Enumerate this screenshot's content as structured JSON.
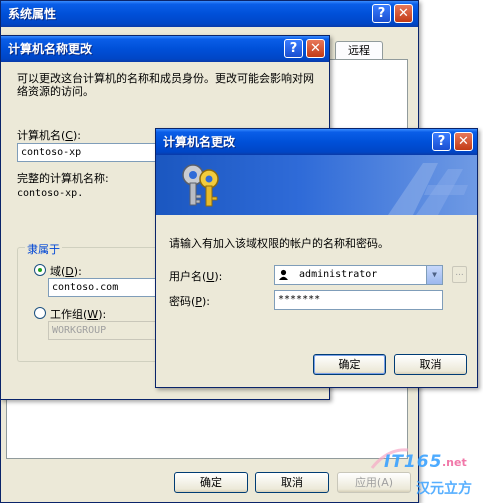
{
  "sysprops": {
    "title": "系统属性",
    "tab_remote": "远程",
    "ok": "确定",
    "cancel": "取消",
    "apply": "应用(A)"
  },
  "rename_dialog": {
    "title": "计算机名称更改",
    "description": "可以更改这台计算机的名称和成员身份。更改可能会影响对网络资源的访问。",
    "computer_name_label_pre": "计算机名(",
    "computer_name_key": "C",
    "computer_name_label_post": "):",
    "computer_name_value": "contoso-xp",
    "full_name_label": "完整的计算机名称:",
    "full_name_value": "contoso-xp.",
    "member_of_label": "隶属于",
    "domain_label_pre": "域(",
    "domain_key": "D",
    "domain_label_post": "):",
    "domain_value": "contoso.com",
    "workgroup_label_pre": "工作组(",
    "workgroup_key": "W",
    "workgroup_label_post": "):",
    "workgroup_value": "WORKGROUP"
  },
  "credentials_dialog": {
    "title": "计算机名更改",
    "prompt": "请输入有加入该域权限的帐户的名称和密码。",
    "username_label_pre": "用户名(",
    "username_key": "U",
    "username_label_post": "):",
    "username_value": "administrator",
    "password_label_pre": "密码(",
    "password_key": "P",
    "password_label_post": "):",
    "password_value": "*******",
    "browse_label": "...",
    "ok": "确定",
    "cancel": "取消"
  },
  "watermark": {
    "brand": "IT165",
    "domain": ".net",
    "tagline": "汉元立方"
  },
  "colors": {
    "title_blue": "#0050d8",
    "banner_blue": "#1f5fc8",
    "accent_group": "#0046d5"
  }
}
